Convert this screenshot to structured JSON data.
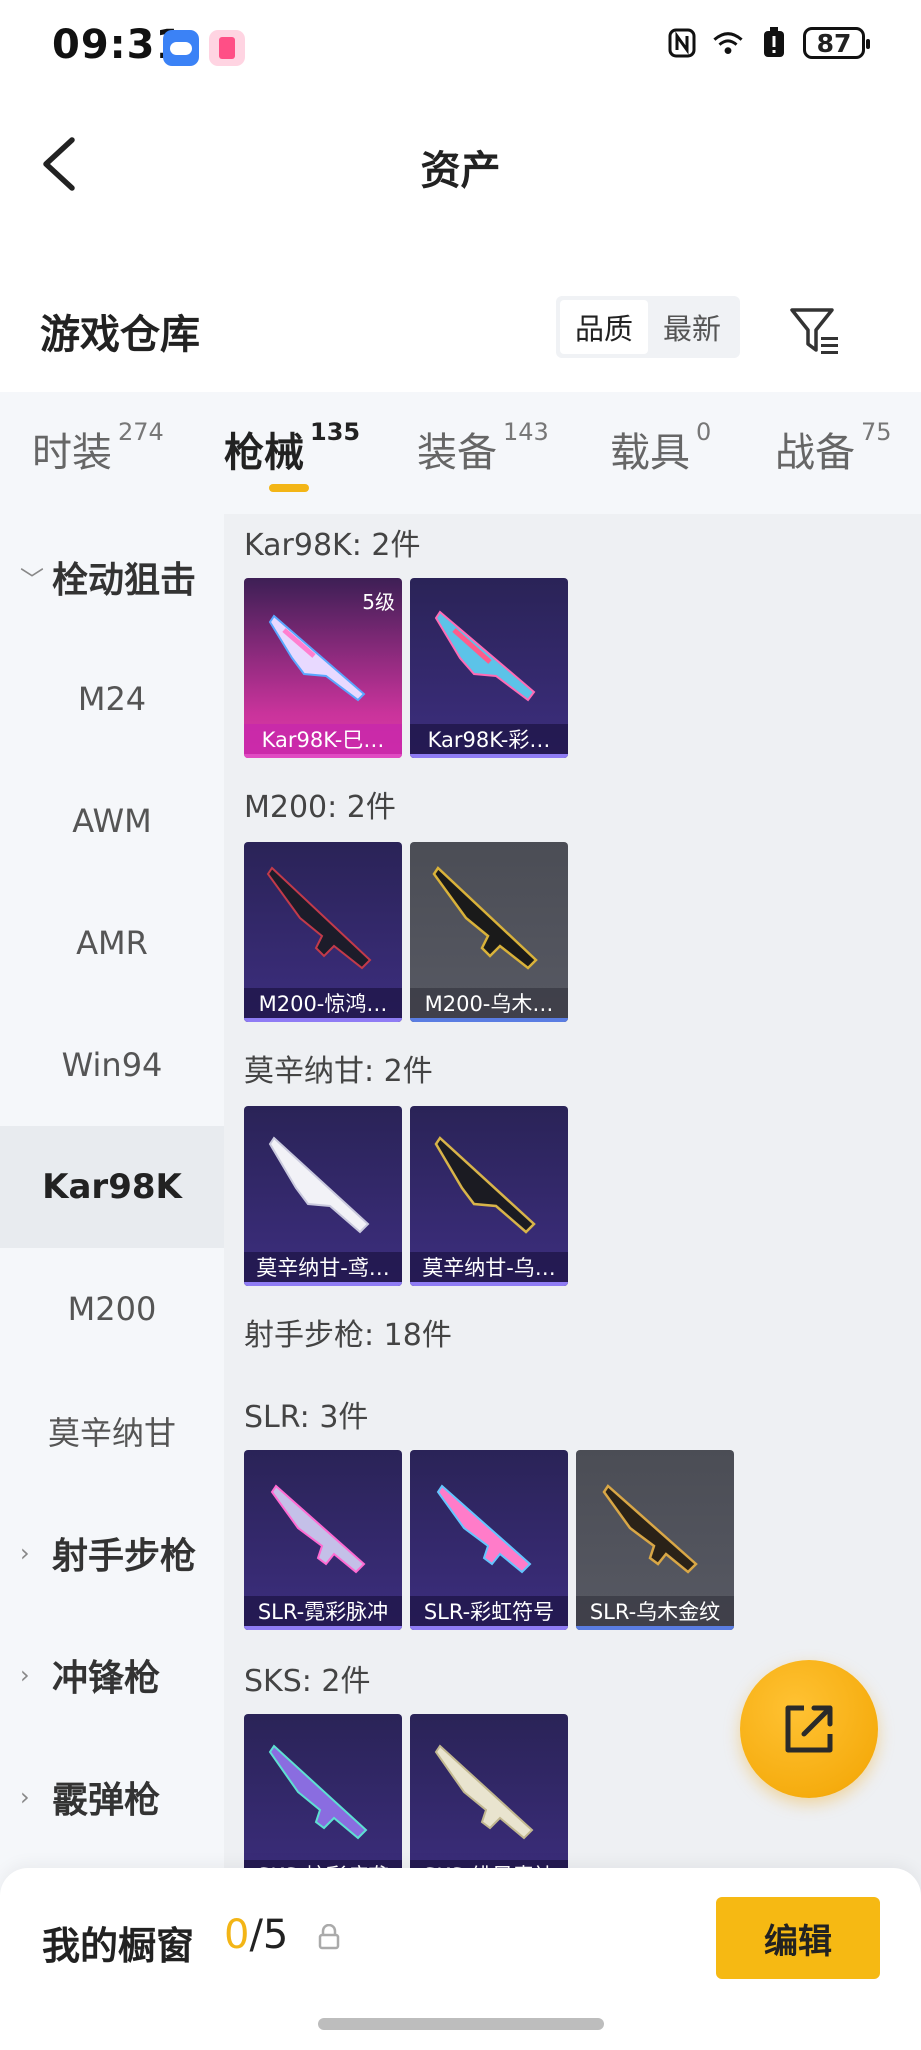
{
  "status_bar": {
    "time": "09:31",
    "battery": "87",
    "icons": [
      "nfc-icon",
      "wifi-icon",
      "battery-alert-icon",
      "battery-icon"
    ]
  },
  "header": {
    "title": "资产",
    "back_icon": "back-arrow-icon"
  },
  "section": {
    "title": "游戏仓库",
    "sort_options": [
      "品质",
      "最新"
    ],
    "sort_active": "品质",
    "filter_icon": "filter-icon"
  },
  "tabs": [
    {
      "label": "时装",
      "count": "274"
    },
    {
      "label": "枪械",
      "count": "135"
    },
    {
      "label": "装备",
      "count": "143"
    },
    {
      "label": "载具",
      "count": "0"
    },
    {
      "label": "战备",
      "count": "75"
    }
  ],
  "active_tab": "枪械",
  "sidebar": [
    {
      "label": "栓动狙击",
      "type": "group",
      "expanded": true
    },
    {
      "label": "M24",
      "type": "item"
    },
    {
      "label": "AWM",
      "type": "item"
    },
    {
      "label": "AMR",
      "type": "item"
    },
    {
      "label": "Win94",
      "type": "item"
    },
    {
      "label": "Kar98K",
      "type": "item",
      "active": true
    },
    {
      "label": "M200",
      "type": "item"
    },
    {
      "label": "莫辛纳甘",
      "type": "item"
    },
    {
      "label": "射手步枪",
      "type": "group",
      "expanded": false
    },
    {
      "label": "冲锋枪",
      "type": "group",
      "expanded": false
    },
    {
      "label": "霰弹枪",
      "type": "group",
      "expanded": false
    }
  ],
  "groups": [
    {
      "label": "Kar98K: 2件",
      "items": [
        {
          "name": "Kar98K-巳…",
          "quality": "pink",
          "badge": "5级"
        },
        {
          "name": "Kar98K-彩…",
          "quality": "purple"
        }
      ]
    },
    {
      "label": "M200: 2件",
      "items": [
        {
          "name": "M200-惊鸿…",
          "quality": "purple"
        },
        {
          "name": "M200-乌木…",
          "quality": "gray"
        }
      ]
    },
    {
      "label": "莫辛纳甘: 2件",
      "items": [
        {
          "name": "莫辛纳甘-鸢…",
          "quality": "purple"
        },
        {
          "name": "莫辛纳甘-乌…",
          "quality": "purple"
        }
      ]
    },
    {
      "label": "射手步枪: 18件",
      "items": []
    },
    {
      "label": "SLR: 3件",
      "items": [
        {
          "name": "SLR-霓彩脉冲",
          "quality": "purple"
        },
        {
          "name": "SLR-彩虹符号",
          "quality": "purple"
        },
        {
          "name": "SLR-乌木金纹",
          "quality": "gray"
        }
      ]
    },
    {
      "label": "SKS: 2件",
      "items": [
        {
          "name": "SKS-炫彩疾袭",
          "quality": "purple"
        },
        {
          "name": "SKS-绯风素袂",
          "quality": "purple"
        }
      ]
    }
  ],
  "fab": {
    "icon": "share-external-icon"
  },
  "bottom_bar": {
    "label": "我的橱窗",
    "current": "0",
    "total": "/5",
    "lock_icon": "lock-icon",
    "edit_label": "编辑"
  },
  "colors": {
    "accent": "#f3b516",
    "card_purple": "#3d2e7f",
    "card_pink": "#e03ba8",
    "card_gray": "#575963"
  }
}
